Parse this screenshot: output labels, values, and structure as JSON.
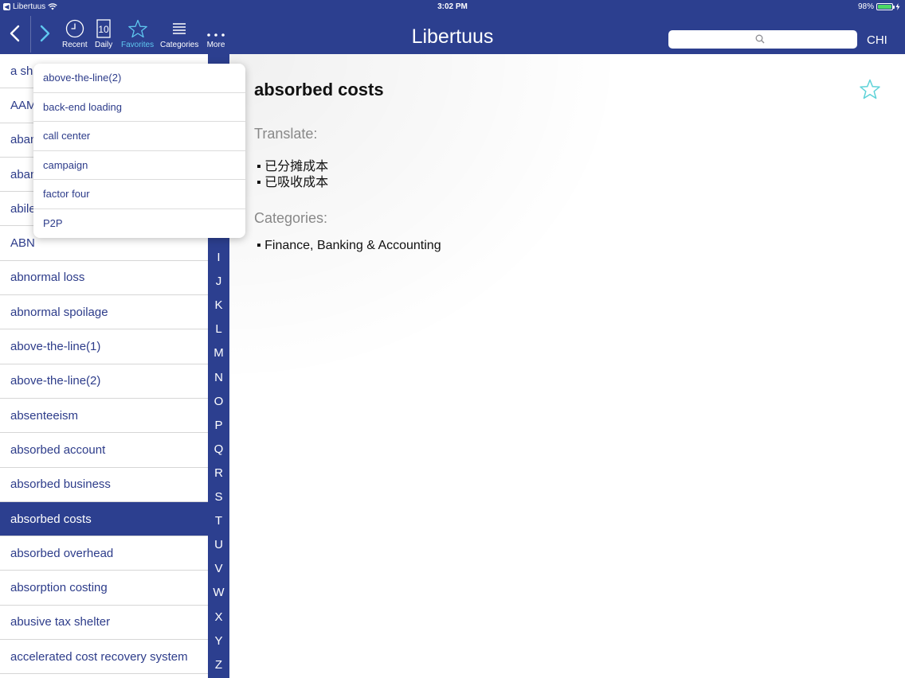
{
  "status_bar": {
    "back_app": "Libertuus",
    "time": "3:02 PM",
    "battery": "98%",
    "battery_level": 0.98
  },
  "toolbar": {
    "back_icon": "chevron-left-icon",
    "forward_icon": "chevron-right-icon",
    "buttons": [
      {
        "label": "Recent",
        "icon": "clock-icon"
      },
      {
        "label": "Daily",
        "icon": "calendar-icon",
        "icon_text": "10"
      },
      {
        "label": "Favorites",
        "icon": "star-icon",
        "active": true
      },
      {
        "label": "Categories",
        "icon": "list-icon"
      },
      {
        "label": "More",
        "icon": "ellipsis-icon"
      }
    ],
    "active_color": "#5fc8f0"
  },
  "app_title": "Libertuus",
  "search": {
    "placeholder": "",
    "value": ""
  },
  "language": "CHI",
  "colors": {
    "brand": "#2c3f8f",
    "list_text": "#2d3c8a",
    "star_outline": "#5fd3d8"
  },
  "word_list": [
    {
      "label": "a sha"
    },
    {
      "label": "AAM"
    },
    {
      "label": "aban"
    },
    {
      "label": "aban"
    },
    {
      "label": "abile"
    },
    {
      "label": "ABN"
    },
    {
      "label": "abnormal loss"
    },
    {
      "label": "abnormal spoilage"
    },
    {
      "label": "above-the-line(1)"
    },
    {
      "label": "above-the-line(2)"
    },
    {
      "label": "absenteeism"
    },
    {
      "label": "absorbed account"
    },
    {
      "label": "absorbed business"
    },
    {
      "label": "absorbed costs",
      "selected": true
    },
    {
      "label": "absorbed overhead"
    },
    {
      "label": "absorption costing"
    },
    {
      "label": "abusive tax shelter"
    },
    {
      "label": "accelerated cost recovery system"
    }
  ],
  "alpha_index": [
    "I",
    "J",
    "K",
    "L",
    "M",
    "N",
    "O",
    "P",
    "Q",
    "R",
    "S",
    "T",
    "U",
    "V",
    "W",
    "X",
    "Y",
    "Z"
  ],
  "favorites_menu": {
    "items": [
      "above-the-line(2)",
      "back-end loading",
      "call center",
      "campaign",
      "factor four",
      "P2P"
    ]
  },
  "detail": {
    "term": "absorbed costs",
    "translate_heading": "Translate:",
    "translations": [
      "已分摊成本",
      "已吸收成本"
    ],
    "categories_heading": "Categories:",
    "categories": [
      "Finance, Banking & Accounting"
    ]
  }
}
